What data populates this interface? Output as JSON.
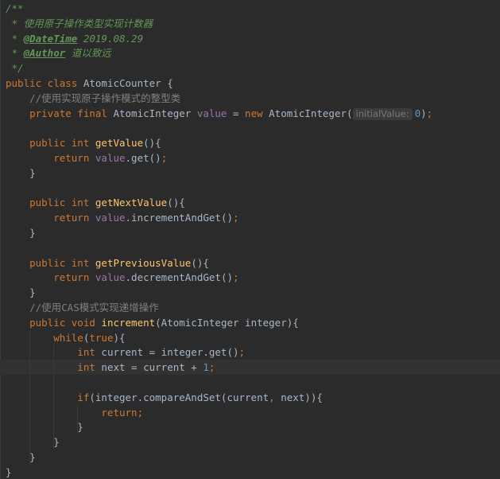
{
  "editor": {
    "language": "java",
    "colors": {
      "background": "#2b2b2b",
      "keyword": "#cc7832",
      "doc_comment": "#629755",
      "line_comment": "#808080",
      "method": "#ffc66d",
      "field": "#9876aa",
      "number": "#6897bb",
      "text": "#a9b7c6",
      "current_line": "#323232"
    },
    "lines": [
      {
        "segments": [
          {
            "cls": "cm",
            "text": "/**"
          }
        ]
      },
      {
        "segments": [
          {
            "cls": "cm",
            "text": " * 使用原子操作类型实现计数器"
          }
        ]
      },
      {
        "segments": [
          {
            "cls": "cm",
            "text": " * "
          },
          {
            "cls": "tag",
            "text": "@DateTime"
          },
          {
            "cls": "cm",
            "text": " 2019.08.29"
          }
        ]
      },
      {
        "segments": [
          {
            "cls": "cm",
            "text": " * "
          },
          {
            "cls": "tag",
            "text": "@Author"
          },
          {
            "cls": "cm",
            "text": " 道以致远"
          }
        ]
      },
      {
        "segments": [
          {
            "cls": "cm",
            "text": " */"
          }
        ]
      },
      {
        "segments": [
          {
            "cls": "kw",
            "text": "public class "
          },
          {
            "cls": "cls",
            "text": "AtomicCounter "
          },
          {
            "cls": "plain",
            "text": "{"
          }
        ]
      },
      {
        "segments": [
          {
            "cls": "lc",
            "text": "    //使用实现原子操作模式的整型类"
          }
        ]
      },
      {
        "segments": [
          {
            "cls": "kw",
            "text": "    private final "
          },
          {
            "cls": "plain",
            "text": "AtomicInteger "
          },
          {
            "cls": "fld",
            "text": "value "
          },
          {
            "cls": "plain",
            "text": "= "
          },
          {
            "cls": "kw",
            "text": "new "
          },
          {
            "cls": "plain",
            "text": "AtomicInteger("
          },
          {
            "cls": "hint",
            "text": "initialValue:"
          },
          {
            "cls": "num",
            "text": "0"
          },
          {
            "cls": "plain",
            "text": ")"
          },
          {
            "cls": "kw",
            "text": ";"
          }
        ]
      },
      {
        "segments": []
      },
      {
        "segments": [
          {
            "cls": "kw",
            "text": "    public int "
          },
          {
            "cls": "fn",
            "text": "getValue"
          },
          {
            "cls": "plain",
            "text": "(){"
          }
        ]
      },
      {
        "segments": [
          {
            "cls": "kw",
            "text": "        return "
          },
          {
            "cls": "fld",
            "text": "value"
          },
          {
            "cls": "plain",
            "text": ".get()"
          },
          {
            "cls": "kw",
            "text": ";"
          }
        ]
      },
      {
        "segments": [
          {
            "cls": "plain",
            "text": "    }"
          }
        ]
      },
      {
        "segments": []
      },
      {
        "segments": [
          {
            "cls": "kw",
            "text": "    public int "
          },
          {
            "cls": "fn",
            "text": "getNextValue"
          },
          {
            "cls": "plain",
            "text": "(){"
          }
        ]
      },
      {
        "segments": [
          {
            "cls": "kw",
            "text": "        return "
          },
          {
            "cls": "fld",
            "text": "value"
          },
          {
            "cls": "plain",
            "text": ".incrementAndGet()"
          },
          {
            "cls": "kw",
            "text": ";"
          }
        ]
      },
      {
        "segments": [
          {
            "cls": "plain",
            "text": "    }"
          }
        ]
      },
      {
        "segments": []
      },
      {
        "segments": [
          {
            "cls": "kw",
            "text": "    public int "
          },
          {
            "cls": "fn",
            "text": "getPreviousValue"
          },
          {
            "cls": "plain",
            "text": "(){"
          }
        ]
      },
      {
        "segments": [
          {
            "cls": "kw",
            "text": "        return "
          },
          {
            "cls": "fld",
            "text": "value"
          },
          {
            "cls": "plain",
            "text": ".decrementAndGet()"
          },
          {
            "cls": "kw",
            "text": ";"
          }
        ]
      },
      {
        "segments": [
          {
            "cls": "plain",
            "text": "    }"
          }
        ]
      },
      {
        "segments": [
          {
            "cls": "lc",
            "text": "    //使用CAS模式实现递增操作"
          }
        ]
      },
      {
        "segments": [
          {
            "cls": "kw",
            "text": "    public void "
          },
          {
            "cls": "fn",
            "text": "increment"
          },
          {
            "cls": "plain",
            "text": "(AtomicInteger integer){"
          }
        ]
      },
      {
        "segments": [
          {
            "cls": "kw",
            "text": "        while"
          },
          {
            "cls": "plain",
            "text": "("
          },
          {
            "cls": "kw",
            "text": "true"
          },
          {
            "cls": "plain",
            "text": "){"
          }
        ]
      },
      {
        "segments": [
          {
            "cls": "kw",
            "text": "            int "
          },
          {
            "cls": "plain",
            "text": "current = integer.get()"
          },
          {
            "cls": "kw",
            "text": ";"
          }
        ]
      },
      {
        "segments": [
          {
            "cls": "kw",
            "text": "            int "
          },
          {
            "cls": "plain",
            "text": "next = current + "
          },
          {
            "cls": "num",
            "text": "1"
          },
          {
            "cls": "kw",
            "text": ";"
          }
        ]
      },
      {
        "segments": []
      },
      {
        "segments": [
          {
            "cls": "kw",
            "text": "            if"
          },
          {
            "cls": "plain",
            "text": "(integer.compareAndSet(current"
          },
          {
            "cls": "kw",
            "text": ", "
          },
          {
            "cls": "plain",
            "text": "next)){"
          }
        ]
      },
      {
        "segments": [
          {
            "cls": "kw",
            "text": "                return;"
          }
        ]
      },
      {
        "segments": [
          {
            "cls": "plain",
            "text": "            }"
          }
        ]
      },
      {
        "segments": [
          {
            "cls": "plain",
            "text": "        }"
          }
        ]
      },
      {
        "segments": [
          {
            "cls": "plain",
            "text": "    }"
          }
        ]
      },
      {
        "segments": [
          {
            "cls": "plain",
            "text": "}"
          }
        ]
      }
    ]
  }
}
